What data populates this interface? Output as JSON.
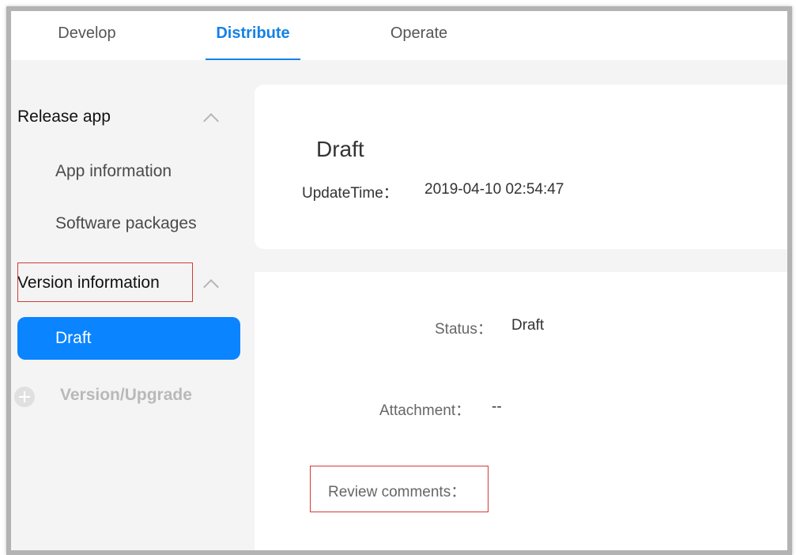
{
  "topnav": {
    "tabs": [
      {
        "label": "Develop"
      },
      {
        "label": "Distribute",
        "active": true
      },
      {
        "label": "Operate"
      }
    ]
  },
  "sidebar": {
    "release_app": {
      "title": "Release app",
      "items": [
        "App information",
        "Software packages"
      ]
    },
    "version_information": {
      "title": "Version information",
      "active_item": "Draft"
    },
    "add_version": "Version/Upgrade"
  },
  "summary": {
    "title": "Draft",
    "update_time_label": "UpdateTime：",
    "update_time_value": "2019-04-10 02:54:47"
  },
  "details": {
    "status_label": "Status：",
    "status_value": "Draft",
    "attachment_label": "Attachment：",
    "attachment_value": "--",
    "review_label": "Review comments："
  },
  "colors": {
    "accent": "#1581e6",
    "active_bg": "#0a84ff",
    "highlight_box": "#d33a3a"
  }
}
